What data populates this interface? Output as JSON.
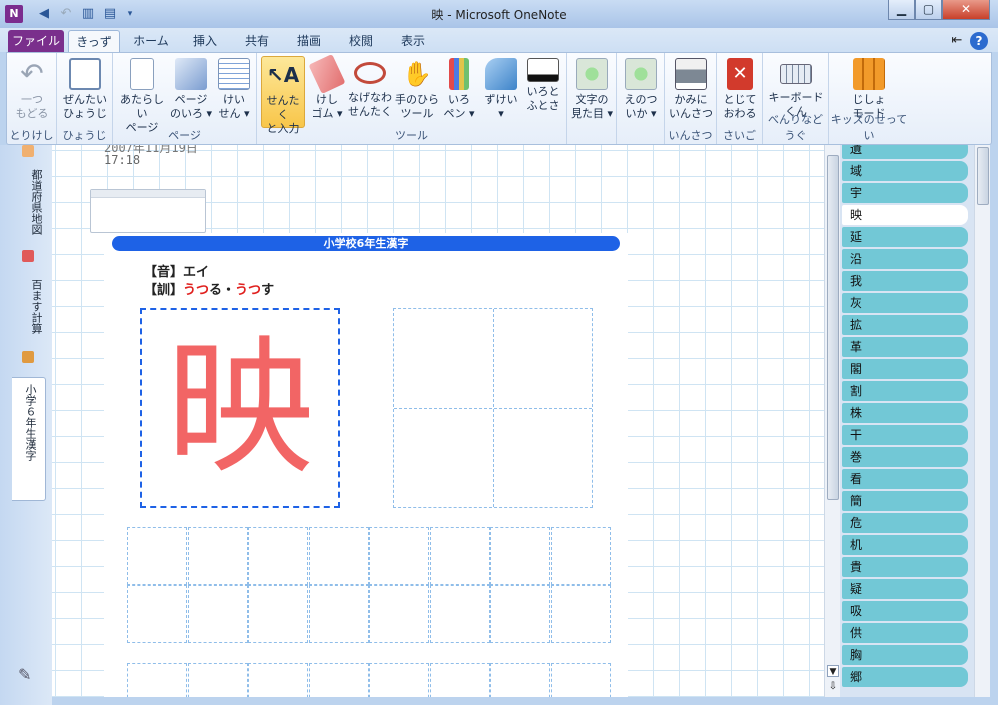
{
  "titlebar": {
    "title": "映 - Microsoft OneNote",
    "logo": "N"
  },
  "tabs": [
    {
      "label": "ファイル"
    },
    {
      "label": "きっず"
    },
    {
      "label": "ホーム"
    },
    {
      "label": "挿入"
    },
    {
      "label": "共有"
    },
    {
      "label": "描画"
    },
    {
      "label": "校閲"
    },
    {
      "label": "表示"
    }
  ],
  "ribbon": {
    "undo": {
      "label1": "一つ",
      "label2": "もどる",
      "group": "とりけし"
    },
    "view": {
      "label1": "ぜんたい",
      "label2": "ひょうじ",
      "group": "ひょうじ"
    },
    "page_new": {
      "label1": "あたらしい",
      "label2": "ページ"
    },
    "page_color": {
      "label1": "ページ",
      "label2": "のいろ ▾"
    },
    "page_lines": {
      "label1": "けい",
      "label2": "せん ▾"
    },
    "page_group": "ページ",
    "select": {
      "label1": "せんたく",
      "label2": "と入力"
    },
    "eraser": {
      "label1": "けし",
      "label2": "ゴム ▾"
    },
    "lasso": {
      "label1": "なげなわ",
      "label2": "せんたく"
    },
    "pan": {
      "label1": "手のひら",
      "label2": "ツール"
    },
    "pen_color": {
      "label1": "いろ",
      "label2": "ペン ▾"
    },
    "shapes": {
      "label1": "ずけい",
      "label2": "▾"
    },
    "thickness": {
      "label1": "いろと",
      "label2": "ふとさ"
    },
    "tools_group": "ツール",
    "text_look": {
      "label1": "文字の",
      "label2": "見た目 ▾"
    },
    "image": {
      "label1": "えのつ",
      "label2": "いか ▾"
    },
    "print": {
      "label1": "かみに",
      "label2": "いんさつ",
      "group": "いんさつ"
    },
    "close": {
      "label1": "とじて",
      "label2": "おわる",
      "group": "さいご"
    },
    "keyboard": {
      "label1": "キーボード",
      "label2": "くん",
      "group": "べんりなどうぐ"
    },
    "dict": {
      "label1": "じしょ",
      "label2": "モード",
      "group": "キッズのせってい"
    }
  },
  "sections": [
    {
      "label": "都道府県地図",
      "color": "#f0b070"
    },
    {
      "label": "百ます計算",
      "color": "#e05a5a"
    },
    {
      "label": "小学６年生漢字",
      "color": "#e09a40"
    }
  ],
  "note": {
    "date": "2007年11月19日",
    "time": "17:18",
    "header": "小学校6年生漢字",
    "on_label": "【音】",
    "on_reading": "エイ",
    "kun_label": "【訓】",
    "kun_red1": "うつ",
    "kun_black1": "る・",
    "kun_red2": "うつ",
    "kun_black2": "す",
    "kanji": "映"
  },
  "pages": [
    "遺",
    "域",
    "宇",
    "映",
    "延",
    "沿",
    "我",
    "灰",
    "拡",
    "革",
    "閣",
    "割",
    "株",
    "干",
    "巻",
    "看",
    "簡",
    "危",
    "机",
    "貴",
    "疑",
    "吸",
    "供",
    "胸",
    "郷"
  ],
  "active_page_index": 3,
  "colors": {
    "accent": "#1e62e6",
    "kanji": "#f26565",
    "page_tab": "#72c8d6"
  }
}
